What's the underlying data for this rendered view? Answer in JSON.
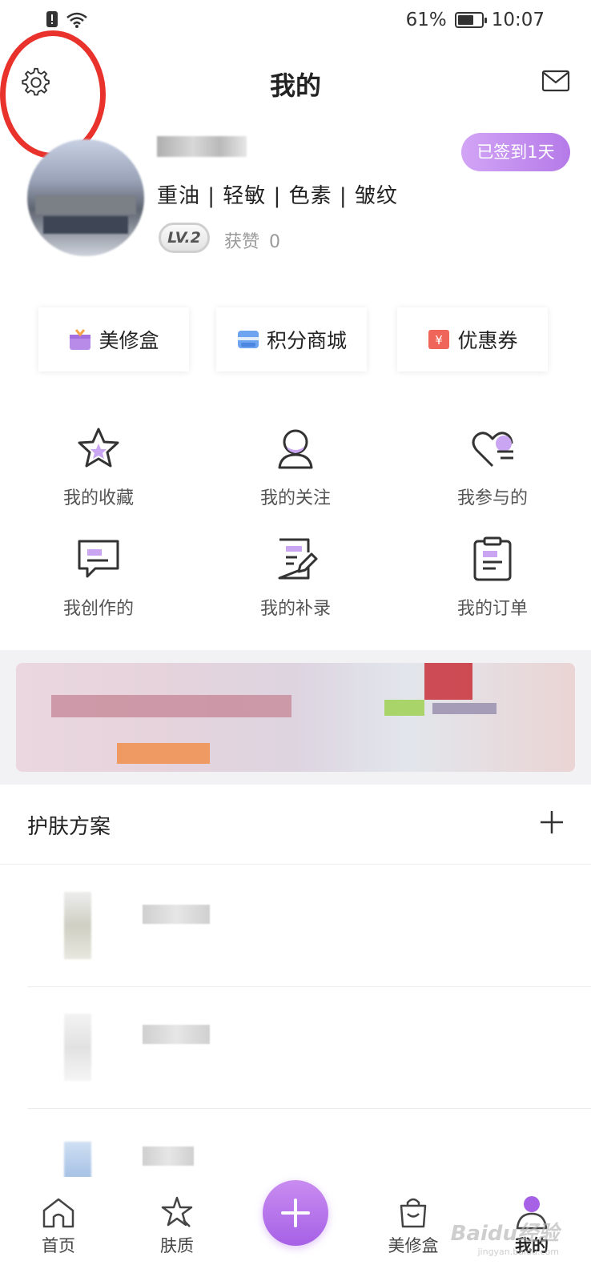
{
  "status_bar": {
    "battery": "61%",
    "time": "10:07",
    "battery_level": 0.61
  },
  "header": {
    "title": "我的"
  },
  "profile": {
    "skin_tags": "重油 | 轻敏 | 色素 | 皱纹",
    "level": "LV.2",
    "likes_label": "获赞",
    "likes_count": "0",
    "checkin_label": "已签到1天"
  },
  "quick_cards": [
    {
      "label": "美修盒",
      "icon": "gift-box-icon"
    },
    {
      "label": "积分商城",
      "icon": "store-icon"
    },
    {
      "label": "优惠券",
      "icon": "coupon-icon"
    }
  ],
  "grid": [
    {
      "label": "我的收藏",
      "icon": "star-icon"
    },
    {
      "label": "我的关注",
      "icon": "person-icon"
    },
    {
      "label": "我参与的",
      "icon": "heart-icon"
    },
    {
      "label": "我创作的",
      "icon": "chat-bubble-icon"
    },
    {
      "label": "我的补录",
      "icon": "edit-note-icon"
    },
    {
      "label": "我的订单",
      "icon": "clipboard-icon"
    }
  ],
  "skin_plan": {
    "title": "护肤方案"
  },
  "tabbar": [
    {
      "label": "首页",
      "icon": "home-icon"
    },
    {
      "label": "肤质",
      "icon": "skin-star-icon"
    },
    {
      "label": "",
      "icon": "plus-icon"
    },
    {
      "label": "美修盒",
      "icon": "bag-icon"
    },
    {
      "label": "我的",
      "icon": "profile-icon"
    }
  ],
  "watermark": {
    "brand": "Baidu经验",
    "url": "jingyan.baidu.com"
  },
  "colors": {
    "accent": "#b57ae8",
    "highlight": "#e8322b"
  }
}
